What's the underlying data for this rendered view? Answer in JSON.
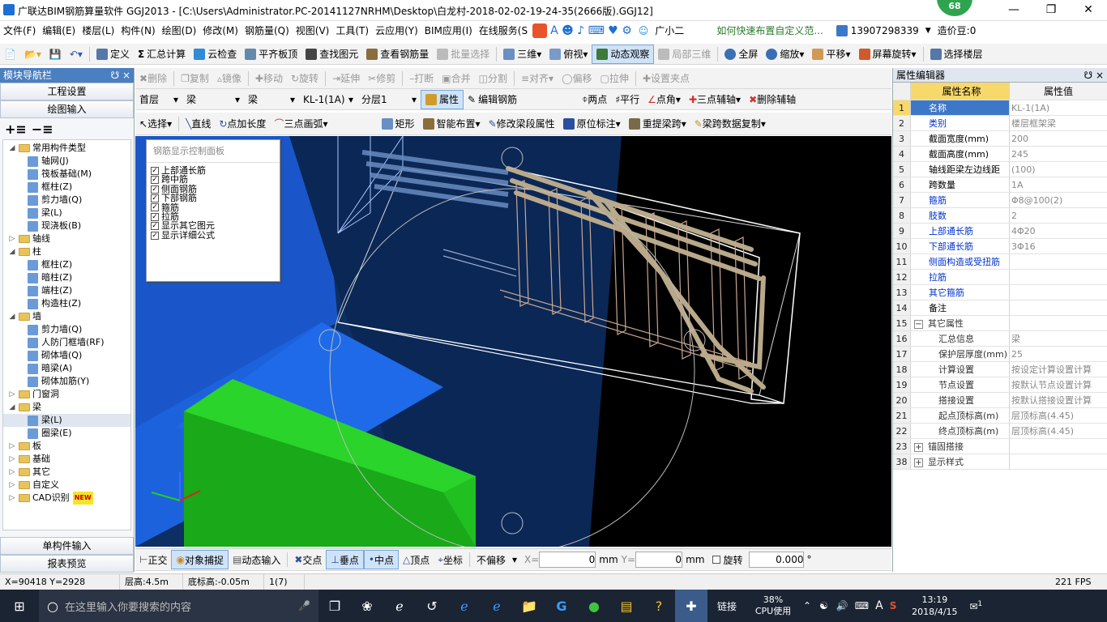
{
  "title": "广联达BIM钢筋算量软件 GGJ2013 - [C:\\Users\\Administrator.PC-20141127NRHM\\Desktop\\白龙村-2018-02-02-19-24-35(2666版).GGJ12]",
  "badge": "68",
  "menu": [
    "文件(F)",
    "编辑(E)",
    "楼层(L)",
    "构件(N)",
    "绘图(D)",
    "修改(M)",
    "钢筋量(Q)",
    "视图(V)",
    "工具(T)",
    "云应用(Y)",
    "BIM应用(I)",
    "在线服务(S"
  ],
  "menu_right": {
    "assistant": "广小二",
    "tip": "如何快速布置自定义范...",
    "phone": "13907298339",
    "price": "造价豆:0"
  },
  "toolbar1": [
    "定义",
    "汇总计算",
    "云检查",
    "平齐板顶",
    "查找图元",
    "查看钢筋量",
    "批量选择",
    "三维",
    "俯视",
    "动态观察",
    "局部三维",
    "全屏",
    "缩放",
    "平移",
    "屏幕旋转",
    "选择楼层"
  ],
  "toolbar2": [
    "删除",
    "复制",
    "镜像",
    "移动",
    "旋转",
    "延伸",
    "修剪",
    "打断",
    "合并",
    "分割",
    "对齐",
    "偏移",
    "拉伸",
    "设置夹点"
  ],
  "toolbar3": {
    "floor": "首层",
    "type1": "梁",
    "type2": "梁",
    "element": "KL-1(1A)",
    "layer": "分层1",
    "props": "属性",
    "edit": "编辑钢筋",
    "right": [
      "两点",
      "平行",
      "点角",
      "三点辅轴",
      "删除辅轴"
    ]
  },
  "toolbar4": [
    "选择",
    "直线",
    "点加长度",
    "三点画弧",
    "矩形",
    "智能布置",
    "修改梁段属性",
    "原位标注",
    "重提梁跨",
    "梁跨数据复制"
  ],
  "nav": {
    "title": "模块导航栏",
    "btn1": "工程设置",
    "btn2": "绘图输入",
    "tree": [
      {
        "lvl": 0,
        "t": "−",
        "f": 1,
        "label": "常用构件类型"
      },
      {
        "lvl": 1,
        "label": "轴网(J)"
      },
      {
        "lvl": 1,
        "label": "筏板基础(M)"
      },
      {
        "lvl": 1,
        "label": "框柱(Z)"
      },
      {
        "lvl": 1,
        "label": "剪力墙(Q)"
      },
      {
        "lvl": 1,
        "label": "梁(L)"
      },
      {
        "lvl": 1,
        "label": "现浇板(B)"
      },
      {
        "lvl": 0,
        "t": "+",
        "f": 1,
        "label": "轴线"
      },
      {
        "lvl": 0,
        "t": "−",
        "f": 1,
        "label": "柱"
      },
      {
        "lvl": 1,
        "label": "框柱(Z)"
      },
      {
        "lvl": 1,
        "label": "暗柱(Z)"
      },
      {
        "lvl": 1,
        "label": "端柱(Z)"
      },
      {
        "lvl": 1,
        "label": "构造柱(Z)"
      },
      {
        "lvl": 0,
        "t": "−",
        "f": 1,
        "label": "墙"
      },
      {
        "lvl": 1,
        "label": "剪力墙(Q)"
      },
      {
        "lvl": 1,
        "label": "人防门框墙(RF)"
      },
      {
        "lvl": 1,
        "label": "砌体墙(Q)"
      },
      {
        "lvl": 1,
        "label": "暗梁(A)"
      },
      {
        "lvl": 1,
        "label": "砌体加筋(Y)"
      },
      {
        "lvl": 0,
        "t": "+",
        "f": 1,
        "label": "门窗洞"
      },
      {
        "lvl": 0,
        "t": "−",
        "f": 1,
        "label": "梁"
      },
      {
        "lvl": 1,
        "label": "梁(L)",
        "sel": true
      },
      {
        "lvl": 1,
        "label": "圈梁(E)"
      },
      {
        "lvl": 0,
        "t": "+",
        "f": 1,
        "label": "板"
      },
      {
        "lvl": 0,
        "t": "+",
        "f": 1,
        "label": "基础"
      },
      {
        "lvl": 0,
        "t": "+",
        "f": 1,
        "label": "其它"
      },
      {
        "lvl": 0,
        "t": "+",
        "f": 1,
        "label": "自定义"
      },
      {
        "lvl": 0,
        "t": "+",
        "f": 1,
        "label": "CAD识别",
        "new": "NEW"
      }
    ],
    "btn3": "单构件输入",
    "btn4": "报表预览"
  },
  "rebar_panel": {
    "title": "钢筋显示控制面板",
    "items": [
      "上部通长筋",
      "跨中筋",
      "侧面钢筋",
      "下部钢筋",
      "箍筋",
      "拉筋",
      "显示其它图元",
      "显示详细公式"
    ]
  },
  "props": {
    "title": "属性编辑器",
    "h1": "属性名称",
    "h2": "属性值",
    "rows": [
      {
        "n": "1",
        "k": "名称",
        "v": "KL-1(1A)",
        "blue": true,
        "sel": true
      },
      {
        "n": "2",
        "k": "类别",
        "v": "楼层框架梁",
        "blue": true
      },
      {
        "n": "3",
        "k": "截面宽度(mm)",
        "v": "200"
      },
      {
        "n": "4",
        "k": "截面高度(mm)",
        "v": "245"
      },
      {
        "n": "5",
        "k": "轴线距梁左边线距",
        "v": "(100)"
      },
      {
        "n": "6",
        "k": "跨数量",
        "v": "1A"
      },
      {
        "n": "7",
        "k": "箍筋",
        "v": "Φ8@100(2)",
        "blue": true
      },
      {
        "n": "8",
        "k": "肢数",
        "v": "2",
        "blue": true
      },
      {
        "n": "9",
        "k": "上部通长筋",
        "v": "4Φ20",
        "blue": true
      },
      {
        "n": "10",
        "k": "下部通长筋",
        "v": "3Φ16",
        "blue": true
      },
      {
        "n": "11",
        "k": "侧面构造或受扭筋",
        "v": "",
        "blue": true
      },
      {
        "n": "12",
        "k": "拉筋",
        "v": "",
        "blue": true
      },
      {
        "n": "13",
        "k": "其它箍筋",
        "v": "",
        "blue": true
      },
      {
        "n": "14",
        "k": "备注",
        "v": ""
      },
      {
        "n": "15",
        "k": "其它属性",
        "v": "",
        "grp": "−"
      },
      {
        "n": "16",
        "k": "汇总信息",
        "v": "梁",
        "ind": true
      },
      {
        "n": "17",
        "k": "保护层厚度(mm)",
        "v": "25",
        "ind": true
      },
      {
        "n": "18",
        "k": "计算设置",
        "v": "按设定计算设置计算",
        "ind": true
      },
      {
        "n": "19",
        "k": "节点设置",
        "v": "按默认节点设置计算",
        "ind": true
      },
      {
        "n": "20",
        "k": "搭接设置",
        "v": "按默认搭接设置计算",
        "ind": true
      },
      {
        "n": "21",
        "k": "起点顶标高(m)",
        "v": "层顶标高(4.45)",
        "ind": true
      },
      {
        "n": "22",
        "k": "终点顶标高(m)",
        "v": "层顶标高(4.45)",
        "ind": true
      },
      {
        "n": "23",
        "k": "锚固搭接",
        "v": "",
        "grp": "+"
      },
      {
        "n": "38",
        "k": "显示样式",
        "v": "",
        "grp": "+"
      }
    ]
  },
  "snapbar": {
    "items": [
      "正交",
      "对象捕捉",
      "动态输入",
      "交点",
      "垂点",
      "中点",
      "顶点",
      "坐标"
    ],
    "offset": "不偏移",
    "x_label": "X=",
    "x_val": "0",
    "y_label": "Y=",
    "y_val": "0",
    "unit": "mm",
    "rotate": "旋转",
    "rot_val": "0.000",
    "deg": "°"
  },
  "status": [
    "X=90418 Y=2928",
    "层高:4.5m",
    "底标高:-0.05m",
    "1(7)",
    "221 FPS"
  ],
  "taskbar": {
    "search": "在这里输入你要搜索的内容",
    "cpu_pct": "38%",
    "cpu_label": "CPU使用",
    "link": "链接",
    "ime": "A",
    "time": "13:19",
    "date": "2018/4/15",
    "notif": "1"
  }
}
